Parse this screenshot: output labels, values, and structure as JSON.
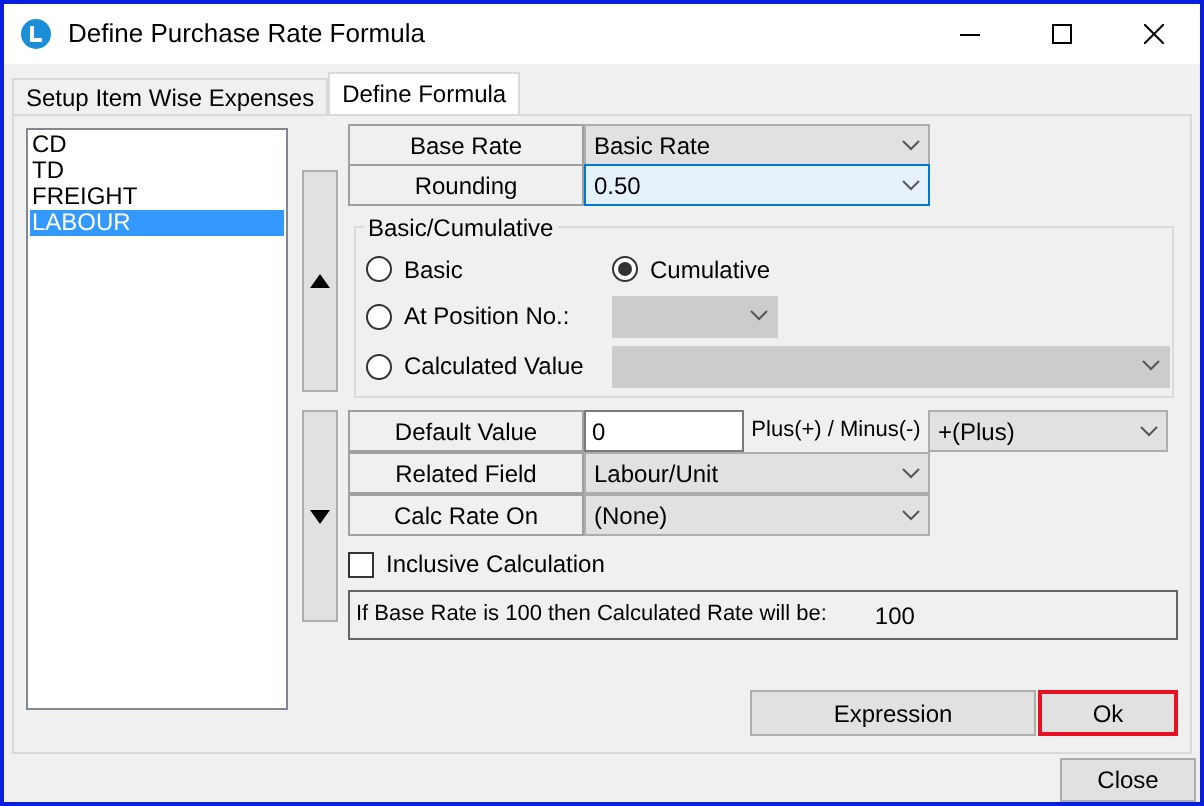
{
  "window": {
    "title": "Define Purchase Rate Formula"
  },
  "tabs": [
    {
      "label": "Setup Item Wise Expenses",
      "selected": false
    },
    {
      "label": "Define Formula",
      "selected": true
    }
  ],
  "list": {
    "items": [
      {
        "label": "CD",
        "selected": false
      },
      {
        "label": "TD",
        "selected": false
      },
      {
        "label": "FREIGHT",
        "selected": false
      },
      {
        "label": "LABOUR",
        "selected": true
      }
    ]
  },
  "base_rate": {
    "label": "Base Rate",
    "value": "Basic Rate",
    "focused": false
  },
  "rounding": {
    "label": "Rounding",
    "value": "0.50",
    "focused": true
  },
  "basic_cumulative": {
    "title": "Basic/Cumulative",
    "options": [
      {
        "label": "Basic",
        "selected": false
      },
      {
        "label": "Cumulative",
        "selected": true
      },
      {
        "label": "At Position No.:",
        "selected": false,
        "select_disabled": true
      },
      {
        "label": "Calculated Value",
        "selected": false,
        "select_disabled": true
      }
    ]
  },
  "default_value": {
    "label": "Default Value",
    "value": "0"
  },
  "plus_minus": {
    "label": "Plus(+) / Minus(-)",
    "value": "+(Plus)"
  },
  "related_field": {
    "label": "Related Field",
    "value": "Labour/Unit",
    "focused": false
  },
  "calc_rate_on": {
    "label": "Calc Rate On",
    "value": "(None)",
    "focused": false
  },
  "inclusive_calculation": {
    "label": "Inclusive Calculation",
    "checked": false
  },
  "result": {
    "text": "If Base Rate is 100 then Calculated Rate will be:",
    "value": "100"
  },
  "buttons": [
    {
      "label": "Expression",
      "highlighted": false
    },
    {
      "label": "Ok",
      "highlighted": true
    }
  ],
  "close_button": {
    "label": "Close"
  }
}
